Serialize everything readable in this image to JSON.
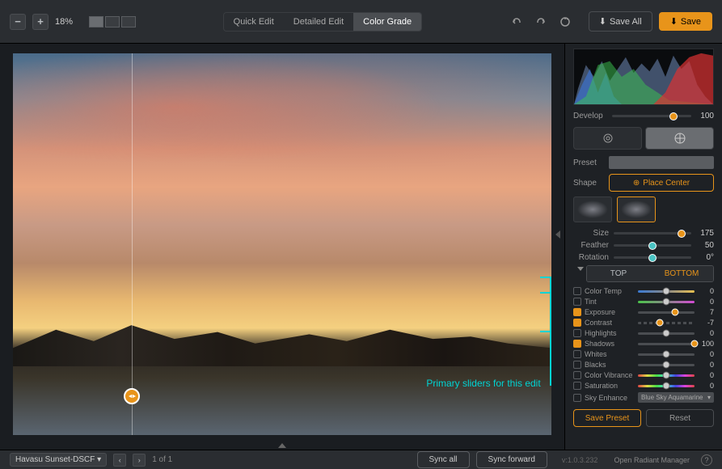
{
  "topbar": {
    "zoom": "18%",
    "modes": [
      "Quick Edit",
      "Detailed Edit",
      "Color Grade"
    ],
    "active_mode": 2,
    "save_all": "Save All",
    "save": "Save"
  },
  "annotation": "Primary sliders for this edit",
  "sidebar": {
    "develop": {
      "label": "Develop",
      "value": 100
    },
    "preset": {
      "label": "Preset"
    },
    "shape": {
      "label": "Shape",
      "place_center": "Place Center"
    },
    "size": {
      "label": "Size",
      "value": 175
    },
    "feather": {
      "label": "Feather",
      "value": 50
    },
    "rotation": {
      "label": "Rotation",
      "value": "0°"
    },
    "top": "TOP",
    "bottom": "BOTTOM",
    "adjustments": [
      {
        "label": "Color Temp",
        "value": 0,
        "checked": false,
        "grad": "grad-temp",
        "pos": 50
      },
      {
        "label": "Tint",
        "value": 0,
        "checked": false,
        "grad": "grad-tint",
        "pos": 50
      },
      {
        "label": "Exposure",
        "value": 7,
        "checked": true,
        "grad": "grad-gray",
        "pos": 65,
        "active": true
      },
      {
        "label": "Contrast",
        "value": -7,
        "checked": true,
        "grad": "grad-gray",
        "pos": 38,
        "active": true,
        "dash": true
      },
      {
        "label": "Highlights",
        "value": 0,
        "checked": false,
        "grad": "grad-gray",
        "pos": 50
      },
      {
        "label": "Shadows",
        "value": 100,
        "checked": true,
        "grad": "grad-gray",
        "pos": 100,
        "active": true
      },
      {
        "label": "Whites",
        "value": 0,
        "checked": false,
        "grad": "grad-gray",
        "pos": 50
      },
      {
        "label": "Blacks",
        "value": 0,
        "checked": false,
        "grad": "grad-gray",
        "pos": 50
      },
      {
        "label": "Color Vibrance",
        "value": 0,
        "checked": false,
        "grad": "grad-spectrum",
        "pos": 50
      },
      {
        "label": "Saturation",
        "value": 0,
        "checked": false,
        "grad": "grad-spectrum",
        "pos": 50
      }
    ],
    "sky_enhance": {
      "label": "Sky Enhance",
      "preset": "Blue Sky Aquamarine"
    },
    "save_preset": "Save Preset",
    "reset": "Reset"
  },
  "bottombar": {
    "filename": "Havasu Sunset-DSCF",
    "page": "1 of 1",
    "sync_all": "Sync all",
    "sync_forward": "Sync forward",
    "version": "v:1.0.3.232",
    "open_manager": "Open Radiant Manager"
  }
}
